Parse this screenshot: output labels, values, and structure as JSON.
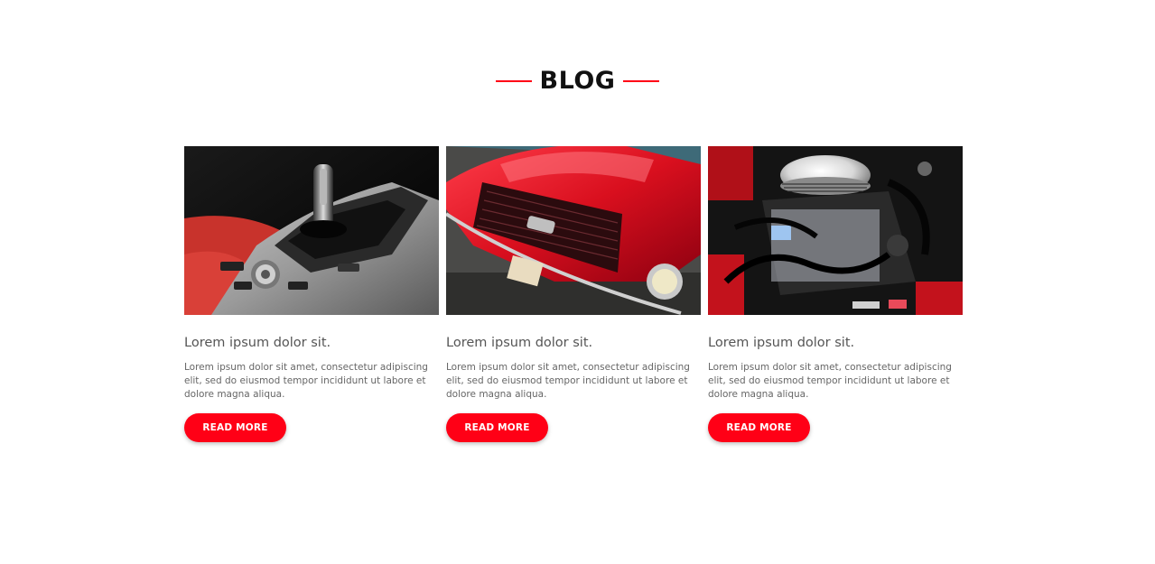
{
  "section": {
    "title": "BLOG",
    "accent_color": "#ff0016"
  },
  "posts": [
    {
      "image": "car-gear-shifter-interior-photo",
      "title": "Lorem ipsum dolor sit.",
      "excerpt": "Lorem ipsum dolor sit amet, consectetur adipiscing elit, sed do eiusmod tempor incididunt ut labore et dolore magna aliqua.",
      "button_label": "READ MORE"
    },
    {
      "image": "red-classic-mustang-front-photo",
      "title": "Lorem ipsum dolor sit.",
      "excerpt": "Lorem ipsum dolor sit amet, consectetur adipiscing elit, sed do eiusmod tempor incididunt ut labore et dolore magna aliqua.",
      "button_label": "READ MORE"
    },
    {
      "image": "chrome-engine-bay-photo",
      "title": "Lorem ipsum dolor sit.",
      "excerpt": "Lorem ipsum dolor sit amet, consectetur adipiscing elit, sed do eiusmod tempor incididunt ut labore et dolore magna aliqua.",
      "button_label": "READ MORE"
    }
  ]
}
